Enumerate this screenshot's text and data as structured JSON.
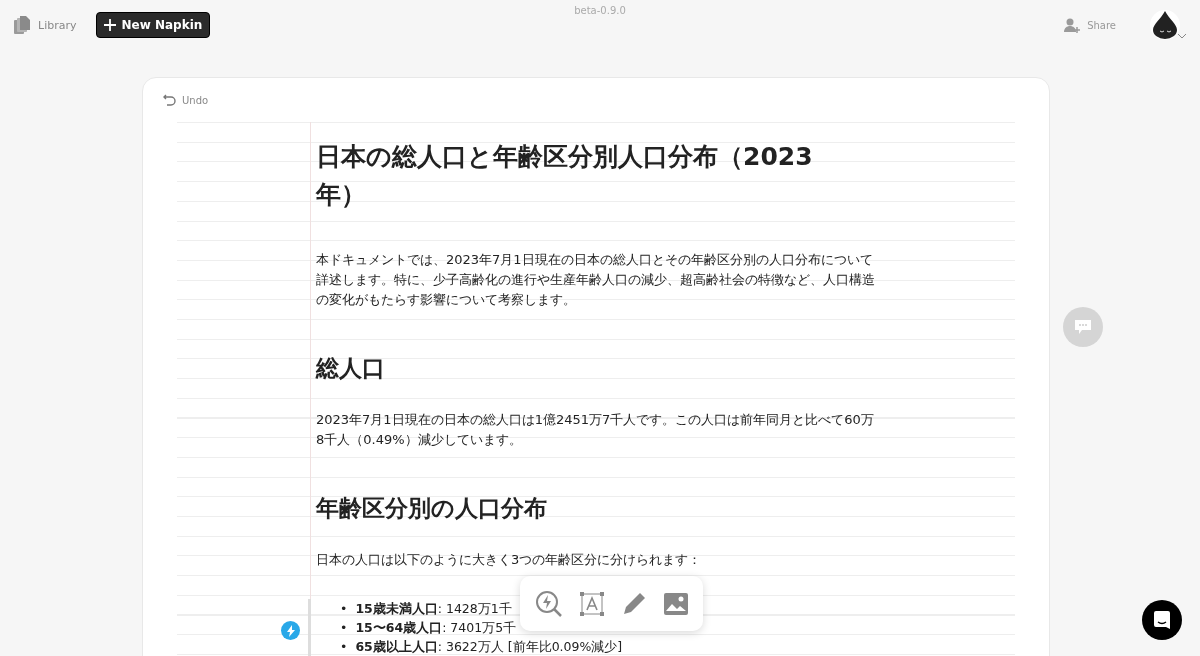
{
  "header": {
    "library": "Library",
    "new_napkin": "New Napkin",
    "version": "beta-0.9.0",
    "share": "Share"
  },
  "editor": {
    "undo": "Undo",
    "blocks": [
      {
        "kind": "title",
        "text": "日本の総人口と年齢区分別人口分布（2023年）"
      },
      {
        "kind": "paragraph",
        "text": "本ドキュメントでは、2023年7月1日現在の日本の総人口とその年齢区分別の人口分布について詳述します。特に、少子高齢化の進行や生産年齢人口の減少、超高齢社会の特徴など、人口構造の変化がもたらす影響について考察します。"
      },
      {
        "kind": "heading",
        "text": "総人口"
      },
      {
        "kind": "paragraph",
        "text": "2023年7月1日現在の日本の総人口は1億2451万7千人です。この人口は前年同月と比べて60万8千人（0.49%）減少しています。"
      },
      {
        "kind": "heading",
        "text": "年齢区分別の人口分布"
      },
      {
        "kind": "paragraph",
        "text": "日本の人口は以下のように大きく3つの年齢区分に分けられます："
      },
      {
        "kind": "bullets",
        "items": [
          {
            "marker": "•",
            "label": "15歳未満人口",
            "value": ": 1428万1千"
          },
          {
            "marker": "•",
            "label": "15〜64歳人口",
            "value": ": 7401万5千"
          },
          {
            "marker": "•",
            "label": "65歳以上人口",
            "value": ": 3622万人 [前年比0.09%減少]"
          }
        ]
      }
    ]
  }
}
